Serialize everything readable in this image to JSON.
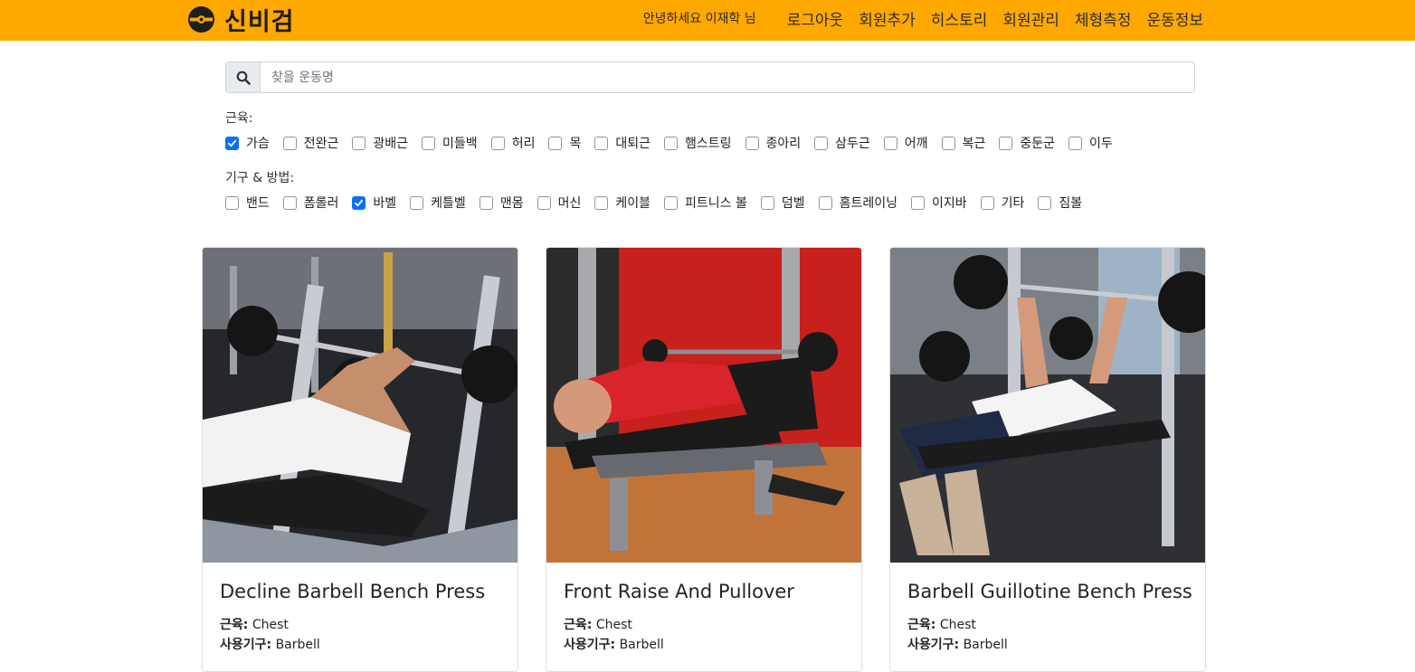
{
  "navbar": {
    "brand": "신비검",
    "greeting": "안녕하세요 이재학 님",
    "links": [
      "로그아웃",
      "회원추가",
      "히스토리",
      "회원관리",
      "체형측정",
      "운동정보"
    ],
    "color": "#ffa800"
  },
  "search": {
    "placeholder": "찾을 운동명",
    "value": ""
  },
  "filters": {
    "muscle_label": "근육:",
    "muscles": [
      {
        "label": "가슴",
        "checked": true
      },
      {
        "label": "전완근",
        "checked": false
      },
      {
        "label": "광배근",
        "checked": false
      },
      {
        "label": "미들백",
        "checked": false
      },
      {
        "label": "허리",
        "checked": false
      },
      {
        "label": "목",
        "checked": false
      },
      {
        "label": "대퇴근",
        "checked": false
      },
      {
        "label": "햄스트링",
        "checked": false
      },
      {
        "label": "종아리",
        "checked": false
      },
      {
        "label": "삼두근",
        "checked": false
      },
      {
        "label": "어깨",
        "checked": false
      },
      {
        "label": "복근",
        "checked": false
      },
      {
        "label": "중둔군",
        "checked": false
      },
      {
        "label": "이두",
        "checked": false
      }
    ],
    "equipment_label": "기구 & 방법:",
    "equipment": [
      {
        "label": "밴드",
        "checked": false
      },
      {
        "label": "폼롤러",
        "checked": false
      },
      {
        "label": "바벨",
        "checked": true
      },
      {
        "label": "케틀벨",
        "checked": false
      },
      {
        "label": "맨몸",
        "checked": false
      },
      {
        "label": "머신",
        "checked": false
      },
      {
        "label": "케이블",
        "checked": false
      },
      {
        "label": "피트니스 볼",
        "checked": false
      },
      {
        "label": "덤벨",
        "checked": false
      },
      {
        "label": "홈트레이닝",
        "checked": false
      },
      {
        "label": "이지바",
        "checked": false
      },
      {
        "label": "기타",
        "checked": false
      },
      {
        "label": "짐볼",
        "checked": false
      }
    ]
  },
  "cards": [
    {
      "title": "Decline Barbell Bench Press",
      "muscle_key": "근육:",
      "muscle": "Chest",
      "equipment_key": "사용기구:",
      "equipment": "Barbell"
    },
    {
      "title": "Front Raise And Pullover",
      "muscle_key": "근육:",
      "muscle": "Chest",
      "equipment_key": "사용기구:",
      "equipment": "Barbell"
    },
    {
      "title": "Barbell Guillotine Bench Press",
      "muscle_key": "근육:",
      "muscle": "Chest",
      "equipment_key": "사용기구:",
      "equipment": "Barbell"
    }
  ],
  "icons": {
    "brand": "dumbbell-plate-icon",
    "search": "search-icon",
    "check": "checkmark-icon"
  }
}
